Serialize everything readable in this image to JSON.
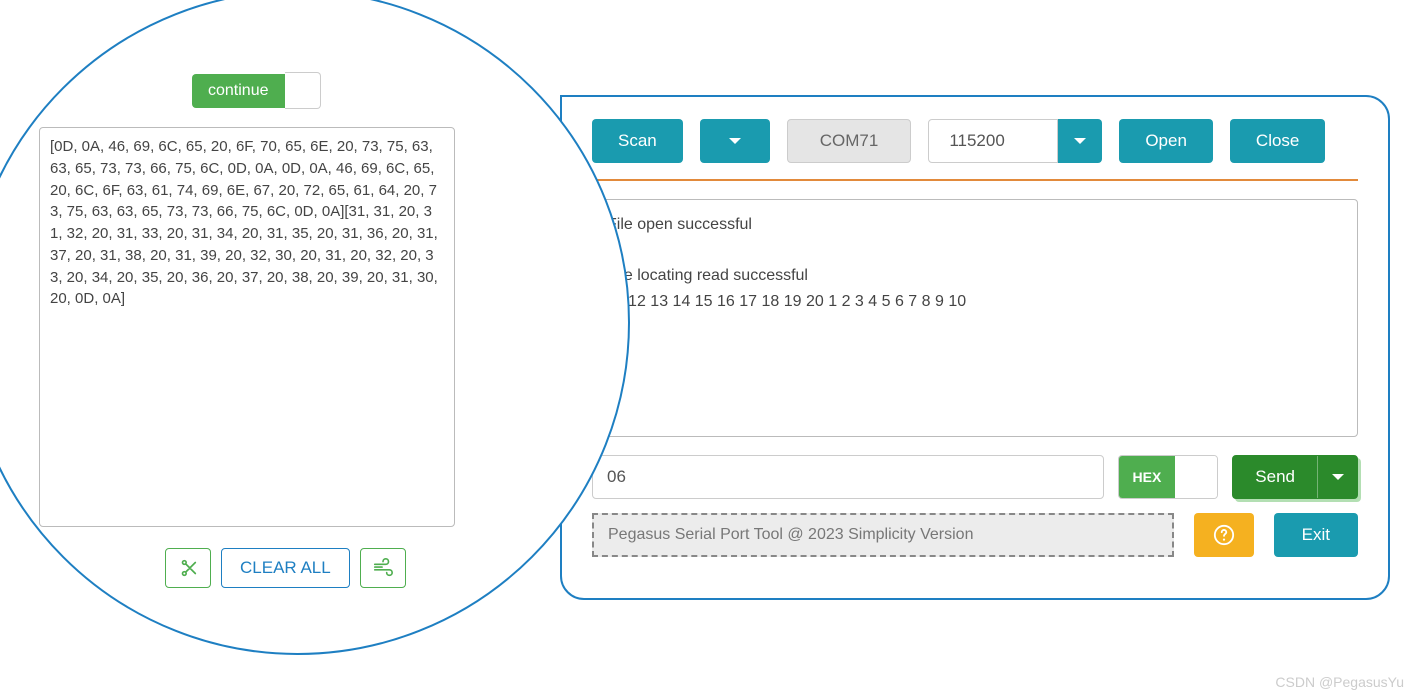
{
  "left": {
    "continue_label": "continue",
    "hex_dump": "[0D, 0A, 46, 69, 6C, 65, 20, 6F, 70, 65, 6E, 20, 73, 75, 63, 63, 65, 73, 73, 66, 75, 6C, 0D, 0A, 0D, 0A, 46, 69, 6C, 65, 20, 6C, 6F, 63, 61, 74, 69, 6E, 67, 20, 72, 65, 61, 64, 20, 73, 75, 63, 63, 65, 73, 73, 66, 75, 6C, 0D, 0A][31, 31, 20, 31, 32, 20, 31, 33, 20, 31, 34, 20, 31, 35, 20, 31, 36, 20, 31, 37, 20, 31, 38, 20, 31, 39, 20, 32, 30, 20, 31, 20, 32, 20, 33, 20, 34, 20, 35, 20, 36, 20, 37, 20, 38, 20, 39, 20, 31, 30, 20, 0D, 0A]",
    "clear_label": "CLEAR ALL"
  },
  "toolbar": {
    "scan": "Scan",
    "port": "COM71",
    "baud": "115200",
    "open": "Open",
    "close": "Close"
  },
  "output_text": "File open successful\n\nFile locating read successful\n11 12 13 14 15 16 17 18 19 20 1 2 3 4 5 6 7 8 9 10",
  "send_row": {
    "input_value": "06",
    "hex_label": "HEX",
    "send_label": "Send"
  },
  "footer": {
    "info": "Pegasus Serial Port Tool @ 2023 Simplicity Version",
    "exit": "Exit"
  },
  "watermark": "CSDN @PegasusYu",
  "colors": {
    "teal": "#1a9baf",
    "green": "#4fae4f",
    "dark_green": "#2b8a2b",
    "blue_border": "#1e7fc2",
    "orange_line": "#e28a3b",
    "amber": "#f5b120"
  }
}
